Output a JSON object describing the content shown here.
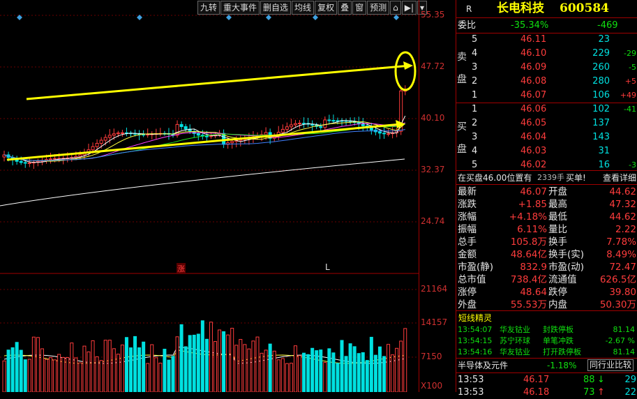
{
  "toolbar": {
    "items": [
      "九转",
      "重大事件",
      "删自选",
      "均线",
      "复权",
      "叠",
      "窗",
      "预测",
      "⌂",
      "▶|",
      "▾"
    ]
  },
  "price_axis": {
    "labels": [
      "55.35",
      "47.72",
      "40.10",
      "32.37",
      "24.74"
    ]
  },
  "volume_axis": {
    "labels": [
      "21164",
      "14157",
      "7150",
      "X100"
    ]
  },
  "chart_markers": {
    "zhang": "涨",
    "l": "L"
  },
  "header": {
    "r": "R",
    "name": "长电科技",
    "code": "600584"
  },
  "webi": {
    "label": "委比",
    "ratio": "-35.34%",
    "diff": "-469"
  },
  "sell": {
    "side_label": "卖盘",
    "rows": [
      {
        "n": "5",
        "price": "46.11",
        "vol": "23",
        "chg": ""
      },
      {
        "n": "4",
        "price": "46.10",
        "vol": "229",
        "chg": "-29"
      },
      {
        "n": "3",
        "price": "46.09",
        "vol": "260",
        "chg": "-5"
      },
      {
        "n": "2",
        "price": "46.08",
        "vol": "280",
        "chg": "+5"
      },
      {
        "n": "1",
        "price": "46.07",
        "vol": "106",
        "chg": "+49"
      }
    ]
  },
  "buy": {
    "side_label": "买盘",
    "rows": [
      {
        "n": "1",
        "price": "46.06",
        "vol": "102",
        "chg": "-41"
      },
      {
        "n": "2",
        "price": "46.05",
        "vol": "137",
        "chg": ""
      },
      {
        "n": "3",
        "price": "46.04",
        "vol": "143",
        "chg": ""
      },
      {
        "n": "4",
        "price": "46.03",
        "vol": "31",
        "chg": ""
      },
      {
        "n": "5",
        "price": "46.02",
        "vol": "16",
        "chg": "-3"
      }
    ]
  },
  "notice": {
    "text": "在买盘46.00位置有",
    "lots": "2339手",
    "buy": "买单!",
    "detail": "查看详细"
  },
  "quote": [
    {
      "l1": "最新",
      "v1": "46.07",
      "l2": "开盘",
      "v2": "44.62"
    },
    {
      "l1": "涨跌",
      "v1": "+1.85",
      "l2": "最高",
      "v2": "47.32"
    },
    {
      "l1": "涨幅",
      "v1": "+4.18%",
      "l2": "最低",
      "v2": "44.62"
    },
    {
      "l1": "振幅",
      "v1": "6.11%",
      "l2": "量比",
      "v2": "2.22"
    },
    {
      "l1": "总手",
      "v1": "105.8万",
      "l2": "换手",
      "v2": "7.78%"
    },
    {
      "l1": "金额",
      "v1": "48.64亿",
      "l2": "换手(实)",
      "v2": "8.49%"
    },
    {
      "l1": "市盈(静)",
      "v1": "832.9",
      "l2": "市盈(动)",
      "v2": "72.47"
    },
    {
      "l1": "总市值",
      "v1": "738.4亿",
      "l2": "流通值",
      "v2": "626.5亿"
    },
    {
      "l1": "涨停",
      "v1": "48.64",
      "l2": "跌停",
      "v2": "39.80"
    },
    {
      "l1": "外盘",
      "v1": "55.53万",
      "l2": "内盘",
      "v2": "50.30万"
    }
  ],
  "genie": {
    "title": "短线精灵",
    "rows": [
      {
        "time": "13:54:07",
        "name": "华友钴业",
        "event": "封跌停板",
        "val": "81.14"
      },
      {
        "time": "13:54:15",
        "name": "苏宁环球",
        "event": "单笔冲跌",
        "val": "-2.67 %"
      },
      {
        "time": "13:54:16",
        "name": "华友钴业",
        "event": "打开跌停板",
        "val": "81.14"
      }
    ]
  },
  "industry": {
    "name": "半导体及元件",
    "chg": "-1.18%",
    "compare": "同行业比较"
  },
  "ticks": [
    {
      "time": "13:53",
      "price": "46.17",
      "vol": "88",
      "arrow": "↓",
      "num": "29"
    },
    {
      "time": "13:53",
      "price": "46.18",
      "vol": "73",
      "arrow": "↑",
      "num": "22"
    }
  ],
  "colors": {
    "up": "#ff3c3c",
    "down": "#00e0e0",
    "trend": "#ffff00",
    "border": "#a00000",
    "bg": "#000000"
  }
}
